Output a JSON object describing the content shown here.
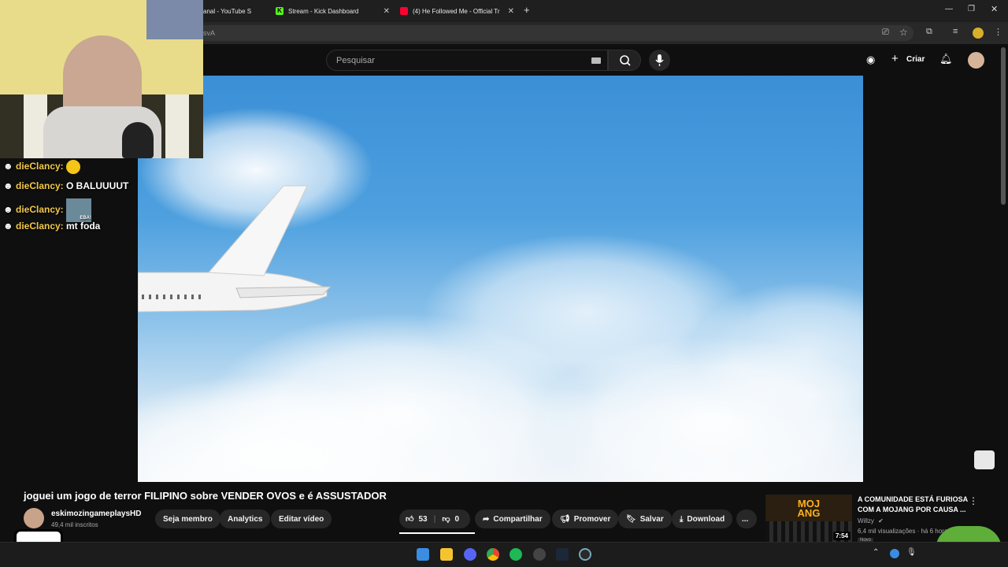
{
  "browser": {
    "tabs": [
      {
        "label": "anal - YouTube S",
        "icon": "youtube-studio-icon"
      },
      {
        "label": "Stream - Kick Dashboard",
        "icon": "kick-icon"
      },
      {
        "label": "(4) He Followed Me - Official Tr",
        "icon": "youtube-icon"
      }
    ],
    "new_tab": "+",
    "url_fragment": "svA"
  },
  "youtube": {
    "search_placeholder": "Pesquisar",
    "create_label": "Criar"
  },
  "chat": [
    {
      "name": "dieClancy:",
      "message": ""
    },
    {
      "name": "dieClancy:",
      "message": "O BALUUUUT"
    },
    {
      "name": "dieClancy:",
      "message": ""
    },
    {
      "name": "dieClancy:",
      "message": "mt foda"
    }
  ],
  "chat_emote_label": "EBA!",
  "video": {
    "title": "joguei um jogo de terror FILIPINO sobre VENDER OVOS e é ASSUSTADOR",
    "channel": "eskimozingameplaysHD",
    "subscribers": "49,4 mil inscritos",
    "buttons": {
      "join": "Seja membro",
      "analytics": "Analytics",
      "edit": "Editar vídeo",
      "likes": "53",
      "dislikes": "0",
      "share": "Compartilhar",
      "promote": "Promover",
      "save": "Salvar",
      "download": "Download",
      "more": "..."
    }
  },
  "recommended": {
    "title": "A COMUNIDADE ESTÁ FURIOSA COM A MOJANG POR CAUSA ...",
    "channel": "Willzy",
    "meta": "6,4 mil visualizações · há 6 horas",
    "duration": "7:54",
    "thumb_text": "MOJ ANG",
    "badge": "Novo"
  }
}
